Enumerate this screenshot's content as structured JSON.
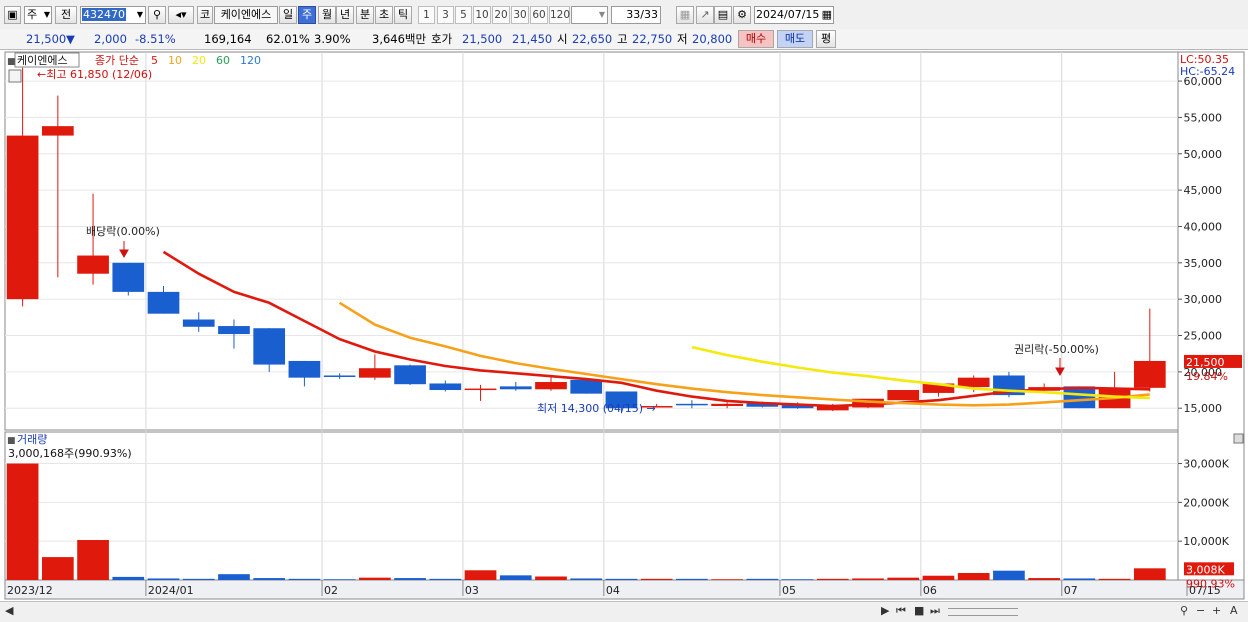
{
  "toolbar": {
    "period_select": "주",
    "prev_label": "전",
    "code_value": "432470",
    "market_label": "코",
    "stock_name": "케이엔에스",
    "period_tabs": [
      "일",
      "주",
      "월",
      "년",
      "분",
      "초",
      "틱"
    ],
    "selected_period": "주",
    "interval_buttons": [
      "1",
      "3",
      "5",
      "10",
      "20",
      "30",
      "60",
      "120"
    ],
    "count": "33/33",
    "date": "2024/07/15"
  },
  "quote": {
    "price": "21,500",
    "change_arrow": "▼",
    "change": "2,000",
    "change_pct": "-8.51%",
    "volume": "169,164",
    "volume_ratio": "62.01%",
    "turnover": "3.90%",
    "amount": "3,646백만",
    "bid_label": "호가",
    "ask": "21,500",
    "bid": "21,450",
    "open_label": "시",
    "open": "22,650",
    "high_label": "고",
    "high": "22,750",
    "low_label": "저",
    "low": "20,800",
    "buy_label": "매수",
    "sell_label": "매도",
    "eval_label": "평"
  },
  "colors": {
    "up": "#e0190d",
    "down": "#1a5fd0",
    "ma5": "#e0190d",
    "ma10": "#f7a11a",
    "ma20": "#f3ea0b",
    "ma60": "#2aa05a",
    "ma120": "#2b7bd6",
    "volume_label_bg": "#e0190d"
  },
  "chart_data": {
    "type": "candlestick",
    "legend": {
      "name": "케이엔에스",
      "items": [
        "종가 단순",
        "5",
        "10",
        "20",
        "60",
        "120"
      ]
    },
    "y_ticks": [
      "15,000",
      "20,000",
      "25,000",
      "30,000",
      "35,000",
      "40,000",
      "45,000",
      "50,000",
      "55,000",
      "60,000"
    ],
    "y_tick_values": [
      15000,
      20000,
      25000,
      30000,
      35000,
      40000,
      45000,
      50000,
      55000,
      60000
    ],
    "ylim": [
      12000,
      64000
    ],
    "x_labels": [
      "2023/12",
      "2024/01",
      "02",
      "03",
      "04",
      "05",
      "06",
      "07",
      "07/15"
    ],
    "x_label_index": [
      0,
      4,
      9,
      13,
      17,
      22,
      26,
      30,
      33
    ],
    "ohlc": [
      [
        30000,
        61850,
        29000,
        52500
      ],
      [
        52500,
        58000,
        33000,
        53800
      ],
      [
        33500,
        44500,
        32000,
        36000
      ],
      [
        35000,
        35000,
        30500,
        31000
      ],
      [
        31000,
        31800,
        28000,
        28000
      ],
      [
        27200,
        28200,
        25500,
        26200
      ],
      [
        26300,
        27200,
        23200,
        25200
      ],
      [
        26000,
        26000,
        20000,
        21000
      ],
      [
        21500,
        21500,
        18000,
        19200
      ],
      [
        19500,
        19800,
        19000,
        19400
      ],
      [
        19200,
        22400,
        18900,
        20500
      ],
      [
        20900,
        21000,
        18200,
        18300
      ],
      [
        18400,
        18800,
        17300,
        17500
      ],
      [
        17500,
        18200,
        16000,
        17700
      ],
      [
        18000,
        18600,
        17400,
        17600
      ],
      [
        17600,
        19500,
        17400,
        18600
      ],
      [
        18900,
        19100,
        17000,
        17000
      ],
      [
        17300,
        17300,
        14300,
        15000
      ],
      [
        15300,
        15600,
        15100,
        15300
      ],
      [
        15600,
        16100,
        15000,
        15500
      ],
      [
        15300,
        15800,
        15000,
        15600
      ],
      [
        15800,
        15900,
        15100,
        15200
      ],
      [
        15500,
        15800,
        14900,
        15000
      ],
      [
        14700,
        15600,
        14600,
        15300
      ],
      [
        15100,
        16200,
        15000,
        16300
      ],
      [
        16100,
        17300,
        16100,
        17500
      ],
      [
        17100,
        18300,
        16600,
        18400
      ],
      [
        17900,
        19500,
        17200,
        19200
      ],
      [
        19500,
        20000,
        16500,
        16800
      ],
      [
        17400,
        18400,
        17300,
        17900
      ],
      [
        18000,
        18000,
        15000,
        15000
      ],
      [
        15000,
        20000,
        15000,
        17800
      ],
      [
        17800,
        28700,
        17300,
        21500
      ]
    ],
    "series": [
      {
        "name": "5",
        "values": [
          null,
          null,
          null,
          null,
          36500,
          33500,
          31000,
          29500,
          27000,
          24500,
          22800,
          21700,
          20800,
          20200,
          19800,
          19400,
          19000,
          18500,
          17400,
          16600,
          16000,
          15700,
          15500,
          15300,
          15500,
          15800,
          16100,
          16700,
          17300,
          17600,
          17800,
          17700,
          17600
        ]
      },
      {
        "name": "10",
        "values": [
          null,
          null,
          null,
          null,
          null,
          null,
          null,
          null,
          null,
          29500,
          26500,
          24700,
          23500,
          22200,
          21200,
          20400,
          19700,
          19000,
          18300,
          17700,
          17200,
          16800,
          16500,
          16200,
          15900,
          15700,
          15500,
          15400,
          15500,
          15800,
          16100,
          16400,
          16900
        ]
      },
      {
        "name": "20",
        "values": [
          null,
          null,
          null,
          null,
          null,
          null,
          null,
          null,
          null,
          null,
          null,
          null,
          null,
          null,
          null,
          null,
          null,
          null,
          null,
          23400,
          22300,
          21400,
          20600,
          19900,
          19400,
          18800,
          18300,
          17700,
          17400,
          17200,
          16900,
          16600,
          16400
        ]
      }
    ],
    "volume": [
      30000,
      5900,
      10300,
      800,
      400,
      300,
      1500,
      500,
      300,
      200,
      600,
      500,
      300,
      2500,
      1200,
      900,
      400,
      300,
      300,
      300,
      200,
      300,
      200,
      300,
      400,
      600,
      1100,
      1800,
      2400,
      500,
      400,
      300,
      3008
    ],
    "volume_ticks": [
      "10,000K",
      "20,000K",
      "30,000K"
    ],
    "volume_tick_values": [
      10000,
      20000,
      30000
    ],
    "volume_ylim": [
      0,
      34000
    ],
    "annotations": {
      "high": "최고 61,850 (12/06)",
      "low": "최저 14,300 (04/15)",
      "dividend": "배당락(0.00%)",
      "rights": "권리락(-50.00%)",
      "lc": "LC:50.35",
      "hc": "HC:-65.24",
      "current_price": "21,500",
      "current_pct": "19.84%",
      "volume_title": "거래량",
      "volume_max": "3,000,168주(990.93%)",
      "current_volume": "3,008K",
      "current_volume_pct": "990.93%"
    }
  }
}
